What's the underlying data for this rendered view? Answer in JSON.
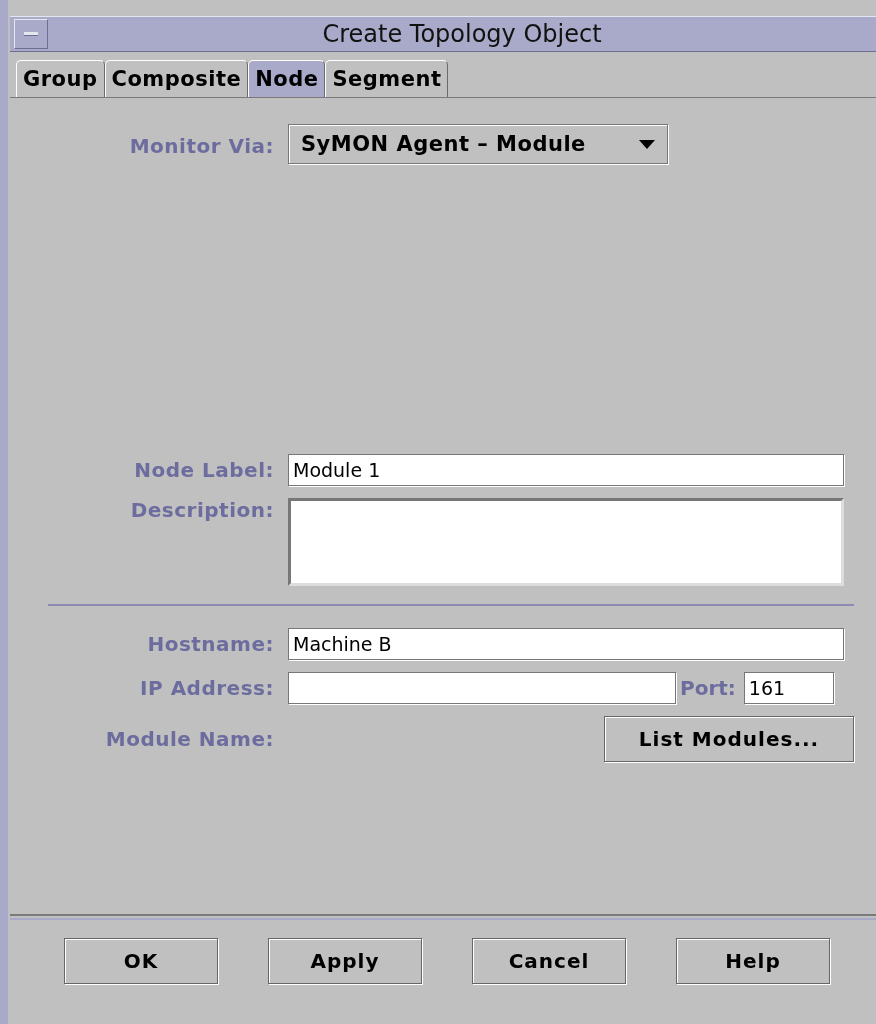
{
  "window": {
    "title": "Create Topology Object"
  },
  "tabs": [
    {
      "label": "Group",
      "selected": false
    },
    {
      "label": "Composite",
      "selected": false
    },
    {
      "label": "Node",
      "selected": true
    },
    {
      "label": "Segment",
      "selected": false
    }
  ],
  "monitor_via": {
    "label": "Monitor Via:",
    "value": "SyMON Agent – Module"
  },
  "node_label": {
    "label": "Node Label:",
    "value": "Module 1"
  },
  "description": {
    "label": "Description:"
  },
  "hostname": {
    "label": "Hostname:",
    "value": "Machine B"
  },
  "ip_address": {
    "label": "IP Address:"
  },
  "port": {
    "label": "Port:",
    "value": "161"
  },
  "module_name": {
    "label": "Module Name:",
    "button": "List Modules..."
  },
  "buttons": [
    "OK",
    "Apply",
    "Cancel",
    "Help"
  ]
}
